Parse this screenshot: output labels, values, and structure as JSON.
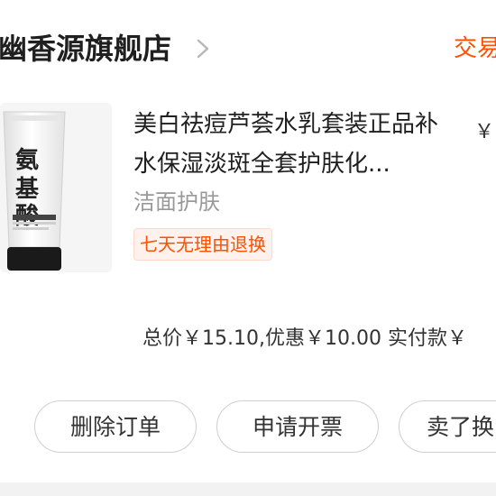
{
  "shop": {
    "name": "幽香源旗舰店",
    "status": "交易"
  },
  "product": {
    "title": "美白祛痘芦荟水乳套装正品补水保湿淡斑全套护肤化...",
    "price": "￥",
    "spec": "洁面护肤",
    "badge": "七天无理由退换",
    "image_text": "氨基酸"
  },
  "summary": {
    "total_label": "总价",
    "total_value": "￥15.10",
    "discount_label": ",优惠",
    "discount_value": "￥10.00",
    "paid_label": " 实付款",
    "paid_value": "￥"
  },
  "actions": {
    "delete": "删除订单",
    "invoice": "申请开票",
    "resell": "卖了换"
  },
  "colors": {
    "accent": "#ff5000",
    "text": "#333333",
    "muted": "#999999"
  }
}
